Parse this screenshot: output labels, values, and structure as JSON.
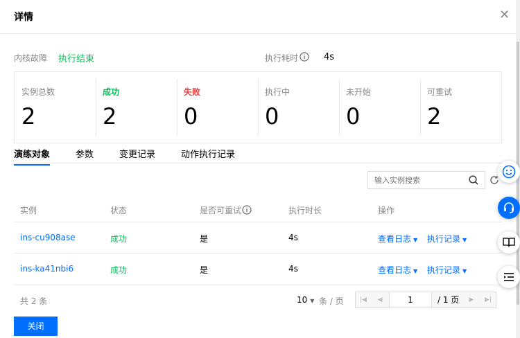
{
  "dialog": {
    "title": "详情"
  },
  "summary": {
    "fault_label": "内核故障",
    "fault_status": "执行结束",
    "duration_label": "执行耗时",
    "duration_value": "4s"
  },
  "stats": [
    {
      "label": "实例总数",
      "value": "2"
    },
    {
      "label": "成功",
      "value": "2"
    },
    {
      "label": "失败",
      "value": "0"
    },
    {
      "label": "执行中",
      "value": "0"
    },
    {
      "label": "未开始",
      "value": "0"
    },
    {
      "label": "可重试",
      "value": "2"
    }
  ],
  "tabs": [
    "演练对象",
    "参数",
    "变更记录",
    "动作执行记录"
  ],
  "search": {
    "placeholder": "输入实例搜索"
  },
  "table": {
    "headers": [
      "实例",
      "状态",
      "是否可重试",
      "执行时长",
      "操作"
    ],
    "rows": [
      {
        "instance": "ins-cu908ase",
        "status": "成功",
        "retryable": "是",
        "duration": "4s",
        "op1": "查看日志",
        "op2": "执行记录"
      },
      {
        "instance": "ins-ka41nbi6",
        "status": "成功",
        "retryable": "是",
        "duration": "4s",
        "op1": "查看日志",
        "op2": "执行记录"
      }
    ]
  },
  "pagination": {
    "total": "共 2 条",
    "page_size": "10",
    "per_page": "条 / 页",
    "current": "1",
    "total_pages": "/ 1 页"
  },
  "footer": {
    "close_label": "关闭"
  },
  "colors": {
    "accent": "#006eff",
    "success": "#0abf5b",
    "danger": "#e54545"
  }
}
